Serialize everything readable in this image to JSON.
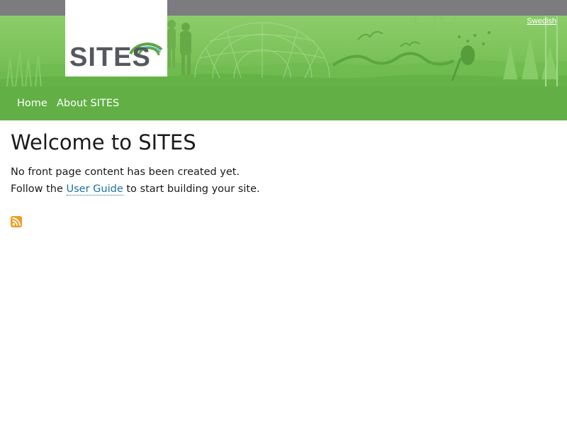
{
  "header": {
    "logo_text": "SITES",
    "language_link": "Swedish"
  },
  "nav": {
    "items": [
      {
        "label": "Home"
      },
      {
        "label": "About SITES"
      }
    ]
  },
  "main": {
    "title": "Welcome to SITES",
    "line1": "No front page content has been created yet.",
    "line2_before": "Follow the ",
    "line2_link": "User Guide",
    "line2_after": " to start building your site."
  },
  "icons": {
    "feed": "rss-feed-icon"
  },
  "colors": {
    "banner_green": "#7cc35a",
    "nav_green": "#62af46",
    "top_bar_gray": "#7b7b80",
    "link_blue": "#1f6fa3",
    "logo_gray": "#55585d",
    "rss_orange": "#f39a1e"
  }
}
